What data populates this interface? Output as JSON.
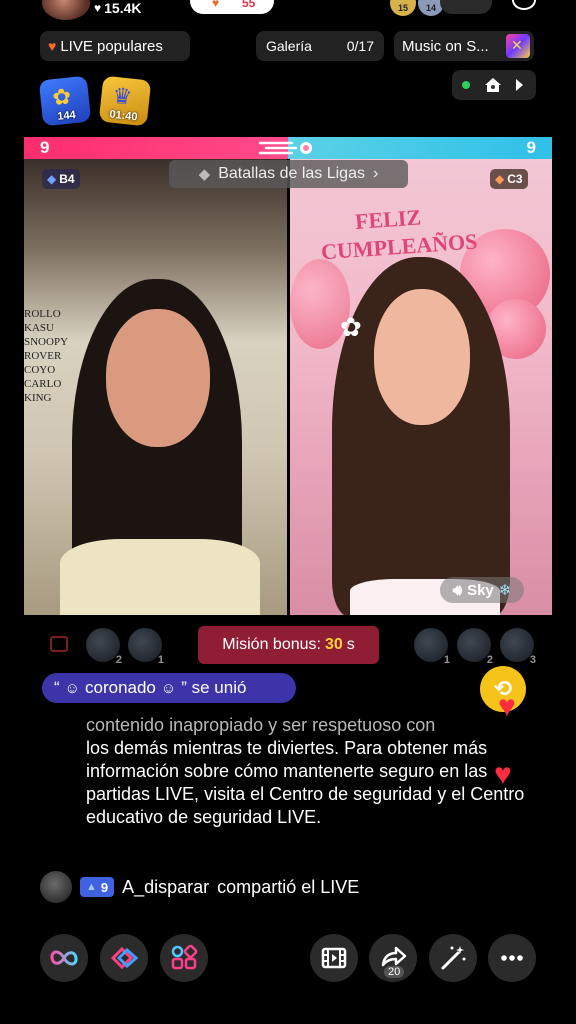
{
  "header": {
    "likes": "15.4K",
    "pill_score": "55",
    "coin_levels": [
      "15",
      "14"
    ]
  },
  "chips": {
    "popular": "LIVE populares",
    "gallery_label": "Galería",
    "gallery_count": "0/17",
    "music": "Music on S..."
  },
  "badges": {
    "paw_caption": "144",
    "treasure_caption": "01:40"
  },
  "battle": {
    "score_left": "9",
    "score_right": "9",
    "league_label": "Batallas de las Ligas",
    "tier_left": "B4",
    "tier_right": "C3",
    "wall_text": [
      "ROLLO",
      "KASU",
      "SNOOPY",
      "ROVER",
      "COYO",
      "CARLO",
      "KING"
    ],
    "banner_text": [
      "FELIZ",
      "CUMPLEAÑOS"
    ],
    "host_tag": "Sky"
  },
  "mission": {
    "label": "Misión bonus:",
    "seconds": "30",
    "unit": "s",
    "left_ranks": [
      "2",
      "1"
    ],
    "right_ranks": [
      "1",
      "2",
      "3"
    ]
  },
  "chat": {
    "joined_prefix": "“",
    "joined_user": "coronado",
    "joined_suffix": "” se unió",
    "safety_faded": "contenido inapropiado y ser respetuoso con",
    "safety_body": "los demás mientras te diviertes. Para obtener más información sobre cómo mantenerte seguro en las partidas LIVE, visita el Centro de seguridad y el Centro educativo de seguridad LIVE.",
    "share_level": "9",
    "share_user": "A_disparar",
    "share_action": "compartió el LIVE"
  },
  "toolbar": {
    "share_count": "20"
  },
  "colors": {
    "battle_left": "#ff2d6e",
    "battle_right": "#2fc0e8",
    "mission_bg": "#8f1e34",
    "joined_bg": "#3c34a8",
    "level_pill": "#3f63e0"
  }
}
